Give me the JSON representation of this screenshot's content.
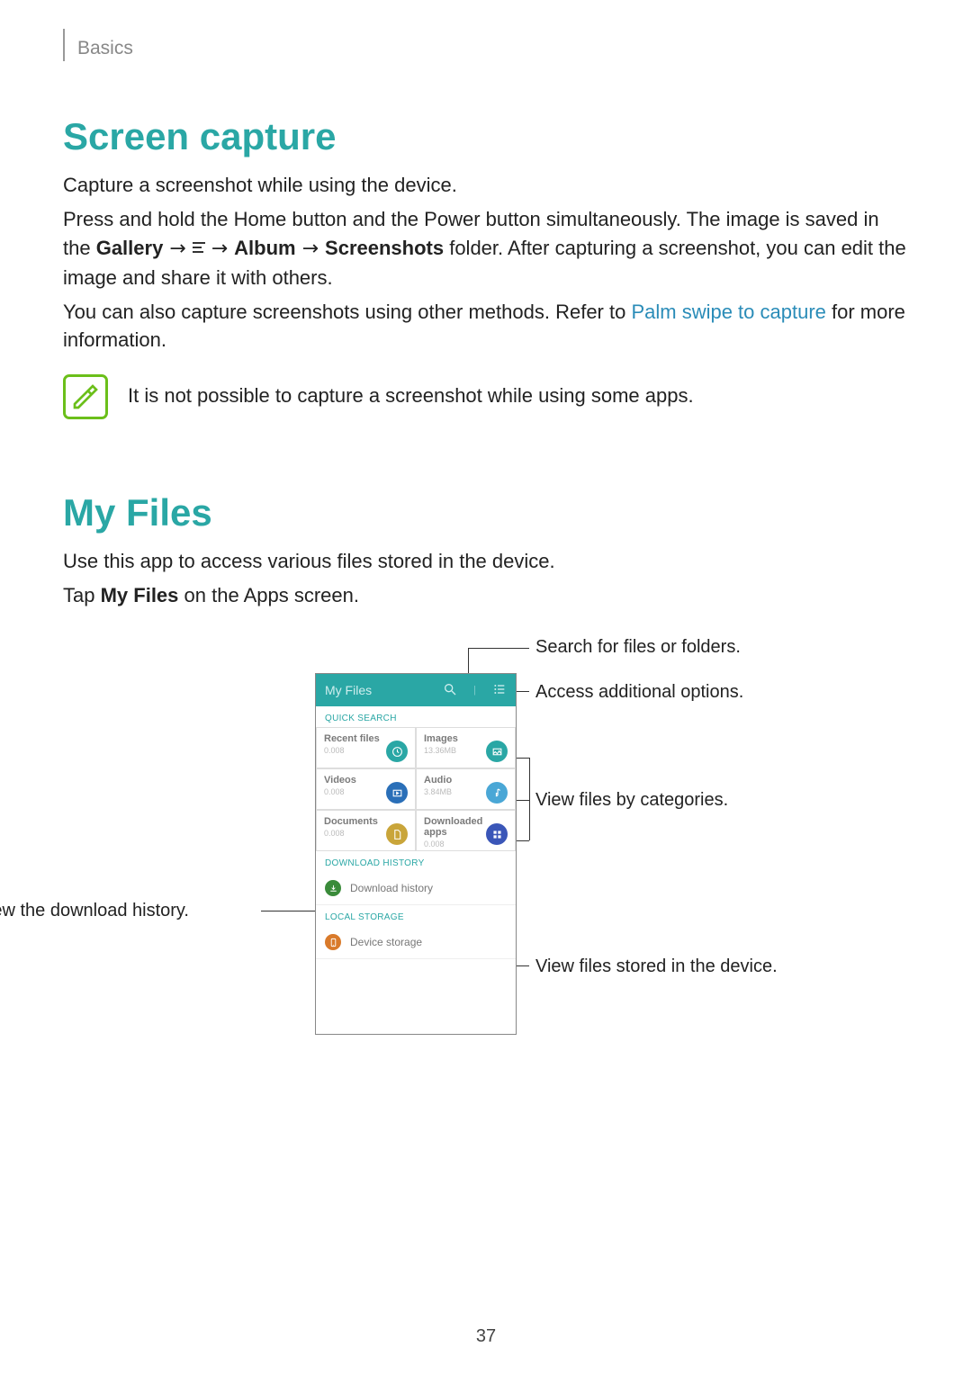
{
  "chapter": "Basics",
  "page_number": "37",
  "section1": {
    "heading": "Screen capture",
    "p1": "Capture a screenshot while using the device.",
    "p2_a": "Press and hold the Home button and the Power button simultaneously. The image is saved in the ",
    "p2_gallery": "Gallery",
    "p2_arrow": " → ",
    "p2_album": "Album",
    "p2_screenshots": "Screenshots",
    "p2_b": " folder. After capturing a screenshot, you can edit the image and share it with others.",
    "p3_a": "You can also capture screenshots using other methods. Refer to ",
    "p3_link": "Palm swipe to capture",
    "p3_b": " for more information.",
    "note": "It is not possible to capture a screenshot while using some apps."
  },
  "section2": {
    "heading": "My Files",
    "p1": "Use this app to access various files stored in the device.",
    "p2_a": "Tap ",
    "p2_bold": "My Files",
    "p2_b": " on the Apps screen."
  },
  "callouts": {
    "search": "Search for files or folders.",
    "options": "Access additional options.",
    "categories": "View files by categories.",
    "download_history": "View the download history.",
    "stored": "View files stored in the device."
  },
  "phone": {
    "title": "My Files",
    "quick_search": "QUICK SEARCH",
    "recent": "Recent files",
    "recent_sub": "0.008",
    "images": "Images",
    "images_sub": "13.36MB",
    "videos": "Videos",
    "videos_sub": "0.008",
    "audio": "Audio",
    "audio_sub": "3.84MB",
    "documents": "Documents",
    "documents_sub": "0.008",
    "downloaded": "Downloaded apps",
    "downloaded_sub": "0.008",
    "dl_history_label": "DOWNLOAD HISTORY",
    "dl_history": "Download history",
    "local_label": "LOCAL STORAGE",
    "device_storage": "Device storage"
  }
}
